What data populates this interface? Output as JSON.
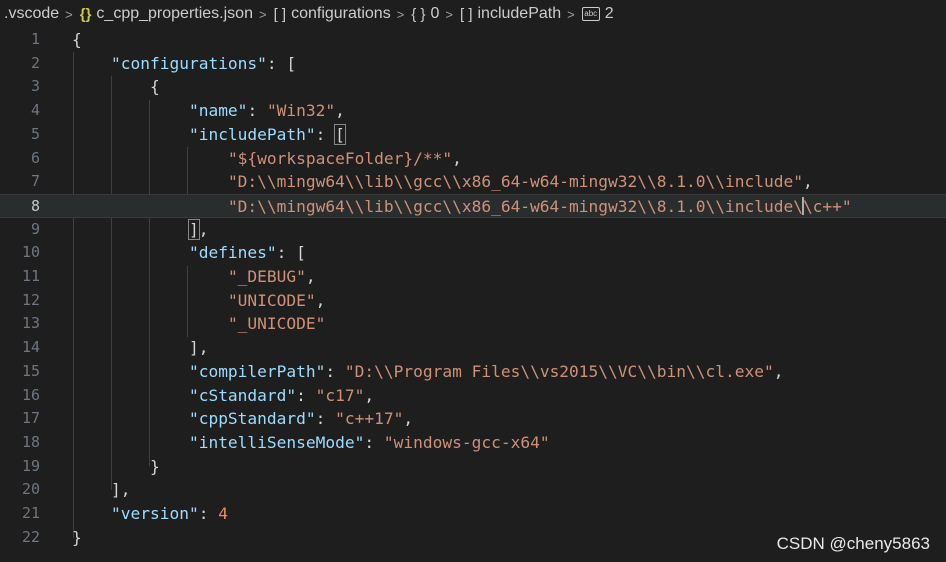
{
  "breadcrumb": {
    "items": [
      {
        "label": ".vscode",
        "icon": ""
      },
      {
        "label": "c_cpp_properties.json",
        "icon": "json-braces-icon"
      },
      {
        "label": "configurations",
        "icon": "array-icon"
      },
      {
        "label": "0",
        "icon": "object-icon"
      },
      {
        "label": "includePath",
        "icon": "array-icon"
      },
      {
        "label": "2",
        "icon": "string-icon"
      }
    ],
    "separator": ">"
  },
  "editor": {
    "current_line": 8,
    "lines": [
      {
        "n": "1"
      },
      {
        "n": "2"
      },
      {
        "n": "3"
      },
      {
        "n": "4"
      },
      {
        "n": "5"
      },
      {
        "n": "6"
      },
      {
        "n": "7"
      },
      {
        "n": "8"
      },
      {
        "n": "9"
      },
      {
        "n": "10"
      },
      {
        "n": "11"
      },
      {
        "n": "12"
      },
      {
        "n": "13"
      },
      {
        "n": "14"
      },
      {
        "n": "15"
      },
      {
        "n": "16"
      },
      {
        "n": "17"
      },
      {
        "n": "18"
      },
      {
        "n": "19"
      },
      {
        "n": "20"
      },
      {
        "n": "21"
      },
      {
        "n": "22"
      }
    ],
    "tokens": {
      "configurations_key": "\"configurations\"",
      "name_key": "\"name\"",
      "name_val": "\"Win32\"",
      "includePath_key": "\"includePath\"",
      "inc1": "\"${workspaceFolder}/**\"",
      "inc2": "\"D:\\\\mingw64\\\\lib\\\\gcc\\\\x86_64-w64-mingw32\\\\8.1.0\\\\include\"",
      "inc3a": "\"D:\\\\mingw64\\\\lib\\\\gcc\\\\x86_64-w64-mingw32\\\\8.1.0\\\\include\\",
      "inc3b": "\\c++\"",
      "defines_key": "\"defines\"",
      "def1": "\"_DEBUG\"",
      "def2": "\"UNICODE\"",
      "def3": "\"_UNICODE\"",
      "compilerPath_key": "\"compilerPath\"",
      "compilerPath_val": "\"D:\\\\Program Files\\\\vs2015\\\\VC\\\\bin\\\\cl.exe\"",
      "cStandard_key": "\"cStandard\"",
      "cStandard_val": "\"c17\"",
      "cppStandard_key": "\"cppStandard\"",
      "cppStandard_val": "\"c++17\"",
      "intelliSenseMode_key": "\"intelliSenseMode\"",
      "intelliSenseMode_val": "\"windows-gcc-x64\"",
      "version_key": "\"version\"",
      "version_val": "4"
    }
  },
  "watermark": "CSDN @cheny5863"
}
